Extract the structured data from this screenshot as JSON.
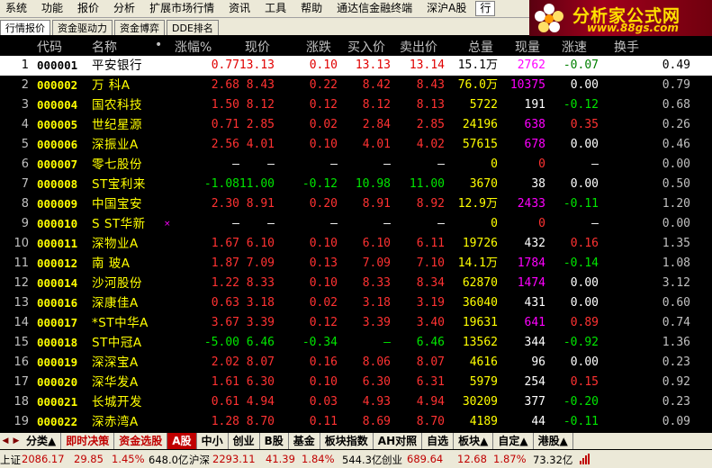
{
  "menu": [
    "系统",
    "功能",
    "报价",
    "分析",
    "扩展市场行情",
    "资讯",
    "工具",
    "帮助",
    "通达信金融终端",
    "深沪A股",
    "行"
  ],
  "logo": {
    "title": "分析家公式网",
    "url": "www.88gs.com"
  },
  "tabs": [
    {
      "label": "行情报价",
      "active": true
    },
    {
      "label": "资金驱动力",
      "active": false
    },
    {
      "label": "资金博弈",
      "active": false
    },
    {
      "label": "DDE排名",
      "active": false
    }
  ],
  "headers": {
    "code": "代码",
    "name": "名称",
    "dot": "•",
    "change_pct": "涨幅%",
    "price": "现价",
    "change": "涨跌",
    "bid": "买入价",
    "ask": "卖出价",
    "volume": "总量",
    "current": "现量",
    "speed": "涨速",
    "turnover": "换手"
  },
  "rows": [
    {
      "idx": "1",
      "code": "000001",
      "name": "平安银行",
      "mark": "",
      "chg": "0.77",
      "price": "13.13",
      "diff": "0.10",
      "bid": "13.13",
      "ask": "13.14",
      "vol": "15.1万",
      "cur": "2762",
      "spd": "-0.07",
      "turn": "0.49",
      "dir": "up",
      "curc": "magenta",
      "spdc": "green",
      "selected": true
    },
    {
      "idx": "2",
      "code": "000002",
      "name": "万  科A",
      "mark": "",
      "chg": "2.68",
      "price": "8.43",
      "diff": "0.22",
      "bid": "8.42",
      "ask": "8.43",
      "vol": "76.0万",
      "cur": "10375",
      "spd": "0.00",
      "turn": "0.79",
      "dir": "up",
      "curc": "magenta",
      "spdc": "white",
      "selected": false
    },
    {
      "idx": "3",
      "code": "000004",
      "name": "国农科技",
      "mark": "",
      "chg": "1.50",
      "price": "8.12",
      "diff": "0.12",
      "bid": "8.12",
      "ask": "8.13",
      "vol": "5722",
      "cur": "191",
      "spd": "-0.12",
      "turn": "0.68",
      "dir": "up",
      "curc": "white",
      "spdc": "green",
      "selected": false
    },
    {
      "idx": "4",
      "code": "000005",
      "name": "世纪星源",
      "mark": "",
      "chg": "0.71",
      "price": "2.85",
      "diff": "0.02",
      "bid": "2.84",
      "ask": "2.85",
      "vol": "24196",
      "cur": "638",
      "spd": "0.35",
      "turn": "0.26",
      "dir": "up",
      "curc": "magenta",
      "spdc": "red",
      "selected": false
    },
    {
      "idx": "5",
      "code": "000006",
      "name": "深振业A",
      "mark": "",
      "chg": "2.56",
      "price": "4.01",
      "diff": "0.10",
      "bid": "4.01",
      "ask": "4.02",
      "vol": "57615",
      "cur": "678",
      "spd": "0.00",
      "turn": "0.46",
      "dir": "up",
      "curc": "magenta",
      "spdc": "white",
      "selected": false
    },
    {
      "idx": "6",
      "code": "000007",
      "name": "零七股份",
      "mark": "",
      "chg": "—",
      "price": "—",
      "diff": "—",
      "bid": "—",
      "ask": "—",
      "vol": "0",
      "cur": "0",
      "spd": "—",
      "turn": "0.00",
      "dir": "none",
      "curc": "red",
      "spdc": "white",
      "selected": false
    },
    {
      "idx": "7",
      "code": "000008",
      "name": "ST宝利来",
      "mark": "",
      "chg": "-1.08",
      "price": "11.00",
      "diff": "-0.12",
      "bid": "10.98",
      "ask": "11.00",
      "vol": "3670",
      "cur": "38",
      "spd": "0.00",
      "turn": "0.50",
      "dir": "down",
      "curc": "white",
      "spdc": "white",
      "selected": false
    },
    {
      "idx": "8",
      "code": "000009",
      "name": "中国宝安",
      "mark": "",
      "chg": "2.30",
      "price": "8.91",
      "diff": "0.20",
      "bid": "8.91",
      "ask": "8.92",
      "vol": "12.9万",
      "cur": "2433",
      "spd": "-0.11",
      "turn": "1.20",
      "dir": "up",
      "curc": "magenta",
      "spdc": "green",
      "selected": false
    },
    {
      "idx": "9",
      "code": "000010",
      "name": "S ST华新",
      "mark": "×",
      "chg": "—",
      "price": "—",
      "diff": "—",
      "bid": "—",
      "ask": "—",
      "vol": "0",
      "cur": "0",
      "spd": "—",
      "turn": "0.00",
      "dir": "none",
      "curc": "red",
      "spdc": "white",
      "selected": false
    },
    {
      "idx": "10",
      "code": "000011",
      "name": "深物业A",
      "mark": "",
      "chg": "1.67",
      "price": "6.10",
      "diff": "0.10",
      "bid": "6.10",
      "ask": "6.11",
      "vol": "19726",
      "cur": "432",
      "spd": "0.16",
      "turn": "1.35",
      "dir": "up",
      "curc": "white",
      "spdc": "red",
      "selected": false
    },
    {
      "idx": "11",
      "code": "000012",
      "name": "南  玻A",
      "mark": "",
      "chg": "1.87",
      "price": "7.09",
      "diff": "0.13",
      "bid": "7.09",
      "ask": "7.10",
      "vol": "14.1万",
      "cur": "1784",
      "spd": "-0.14",
      "turn": "1.08",
      "dir": "up",
      "curc": "magenta",
      "spdc": "green",
      "selected": false
    },
    {
      "idx": "12",
      "code": "000014",
      "name": "沙河股份",
      "mark": "",
      "chg": "1.22",
      "price": "8.33",
      "diff": "0.10",
      "bid": "8.33",
      "ask": "8.34",
      "vol": "62870",
      "cur": "1474",
      "spd": "0.00",
      "turn": "3.12",
      "dir": "up",
      "curc": "magenta",
      "spdc": "white",
      "selected": false
    },
    {
      "idx": "13",
      "code": "000016",
      "name": "深康佳A",
      "mark": "",
      "chg": "0.63",
      "price": "3.18",
      "diff": "0.02",
      "bid": "3.18",
      "ask": "3.19",
      "vol": "36040",
      "cur": "431",
      "spd": "0.00",
      "turn": "0.60",
      "dir": "up",
      "curc": "white",
      "spdc": "white",
      "selected": false
    },
    {
      "idx": "14",
      "code": "000017",
      "name": "*ST中华A",
      "mark": "",
      "chg": "3.67",
      "price": "3.39",
      "diff": "0.12",
      "bid": "3.39",
      "ask": "3.40",
      "vol": "19631",
      "cur": "641",
      "spd": "0.89",
      "turn": "0.74",
      "dir": "up",
      "curc": "magenta",
      "spdc": "red",
      "selected": false
    },
    {
      "idx": "15",
      "code": "000018",
      "name": "ST中冠A",
      "mark": "",
      "chg": "-5.00",
      "price": "6.46",
      "diff": "-0.34",
      "bid": "—",
      "ask": "6.46",
      "vol": "13562",
      "cur": "344",
      "spd": "-0.92",
      "turn": "1.36",
      "dir": "down",
      "curc": "white",
      "spdc": "green",
      "selected": false
    },
    {
      "idx": "16",
      "code": "000019",
      "name": "深深宝A",
      "mark": "",
      "chg": "2.02",
      "price": "8.07",
      "diff": "0.16",
      "bid": "8.06",
      "ask": "8.07",
      "vol": "4616",
      "cur": "96",
      "spd": "0.00",
      "turn": "0.23",
      "dir": "up",
      "curc": "white",
      "spdc": "white",
      "selected": false
    },
    {
      "idx": "17",
      "code": "000020",
      "name": "深华发A",
      "mark": "",
      "chg": "1.61",
      "price": "6.30",
      "diff": "0.10",
      "bid": "6.30",
      "ask": "6.31",
      "vol": "5979",
      "cur": "254",
      "spd": "0.15",
      "turn": "0.92",
      "dir": "up",
      "curc": "white",
      "spdc": "red",
      "selected": false
    },
    {
      "idx": "18",
      "code": "000021",
      "name": "长城开发",
      "mark": "",
      "chg": "0.61",
      "price": "4.94",
      "diff": "0.03",
      "bid": "4.93",
      "ask": "4.94",
      "vol": "30209",
      "cur": "377",
      "spd": "-0.20",
      "turn": "0.23",
      "dir": "up",
      "curc": "white",
      "spdc": "green",
      "selected": false
    },
    {
      "idx": "19",
      "code": "000022",
      "name": "深赤湾A",
      "mark": "",
      "chg": "1.28",
      "price": "8.70",
      "diff": "0.11",
      "bid": "8.69",
      "ask": "8.70",
      "vol": "4189",
      "cur": "44",
      "spd": "-0.11",
      "turn": "0.09",
      "dir": "up",
      "curc": "white",
      "spdc": "green",
      "selected": false
    }
  ],
  "bottom_tabs": [
    {
      "label": "分类▲",
      "style": "normal"
    },
    {
      "label": "即时决策",
      "style": "red"
    },
    {
      "label": "资金选股",
      "style": "red"
    },
    {
      "label": "A股",
      "style": "sel"
    },
    {
      "label": "中小",
      "style": "normal"
    },
    {
      "label": "创业",
      "style": "normal"
    },
    {
      "label": "B股",
      "style": "normal"
    },
    {
      "label": "基金",
      "style": "normal"
    },
    {
      "label": "板块指数",
      "style": "normal"
    },
    {
      "label": "AH对照",
      "style": "normal"
    },
    {
      "label": "自选",
      "style": "normal"
    },
    {
      "label": "板块▲",
      "style": "normal"
    },
    {
      "label": "自定▲",
      "style": "normal"
    },
    {
      "label": "港股▲",
      "style": "normal"
    }
  ],
  "status": {
    "sh_label": "上证",
    "sh_index": "2086.17",
    "sh_chg": "29.85",
    "sh_pct": "1.45%",
    "sh_amt": "648.0亿",
    "hs_label": "沪深",
    "hs_index": "2293.11",
    "hs_chg": "41.39",
    "hs_pct": "1.84%",
    "hs_amt": "544.3亿",
    "cy_label": "创业",
    "cy_index": "689.64",
    "cy_chg": "12.68",
    "cy_pct": "1.87%",
    "cy_amt": "73.32亿"
  }
}
